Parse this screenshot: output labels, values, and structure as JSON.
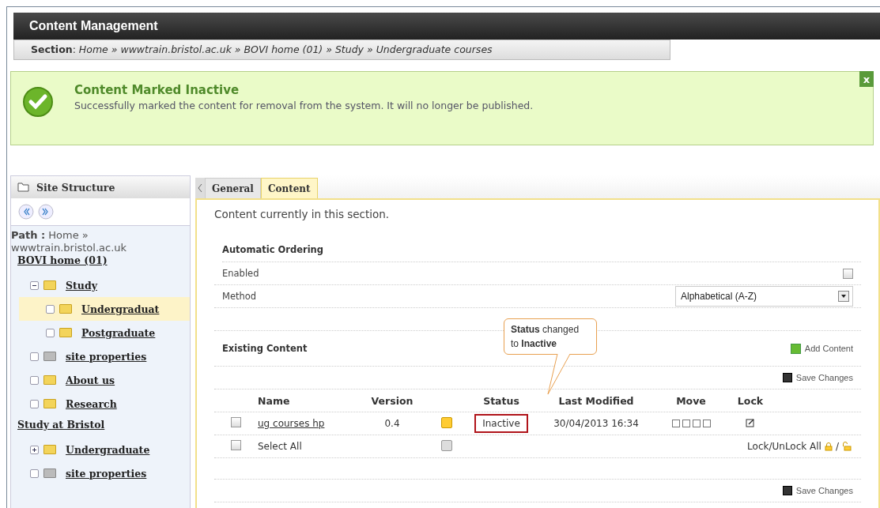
{
  "header": {
    "title": "Content Management",
    "breadcrumb": "**Section**: *Home » wwwtrain.bristol.ac.uk » BOVI home (01) » Study » Undergraduate courses*"
  },
  "message": {
    "title": "Content Marked Inactive",
    "text": "Successfully marked the content for removal from the system. It will no longer be published.",
    "close": "x"
  },
  "sidebar": {
    "title": "Site Structure",
    "path_label": "Path :",
    "path": "Home » wwwtrain.bristol.ac.uk",
    "roots": [
      {
        "label": "BOVI home (01)",
        "children": [
          {
            "label": "Study",
            "kind": "folder",
            "expanded": true,
            "selected": false,
            "children": [
              {
                "label": "Undergraduat",
                "kind": "folder",
                "selected": true
              },
              {
                "label": "Postgraduate",
                "kind": "folder",
                "selected": false
              }
            ]
          },
          {
            "label": "site properties",
            "kind": "properties",
            "selected": false
          },
          {
            "label": "About us",
            "kind": "folder",
            "selected": false
          },
          {
            "label": "Research",
            "kind": "folder",
            "selected": false
          }
        ]
      },
      {
        "label": "Study at Bristol",
        "children": [
          {
            "label": "Undergraduate",
            "kind": "folder",
            "expanded": false,
            "selected": false
          },
          {
            "label": "site properties",
            "kind": "properties",
            "selected": false
          }
        ]
      }
    ]
  },
  "tabs": [
    {
      "label": "General",
      "selected": false
    },
    {
      "label": "Content",
      "selected": true
    }
  ],
  "intro": "Content currently in this section.",
  "ordering": {
    "title": "Automatic Ordering",
    "enabled_label": "Enabled",
    "enabled": false,
    "method_label": "Method",
    "method": "Alphabetical (A-Z)"
  },
  "existing": {
    "title": "Existing Content",
    "add": "Add Content",
    "save": "Save Changes",
    "columns": [
      "Name",
      "Version",
      "Status",
      "Last Modified",
      "Move",
      "Lock"
    ],
    "rows": [
      {
        "checked": false,
        "name": "ug courses hp",
        "version": "0.4",
        "status": "Inactive",
        "highlighted": true,
        "modified": "30/04/2013 16:34"
      }
    ],
    "select_all": "Select All",
    "select_all_checked": false,
    "lock_all": "Lock/UnLock All",
    "slash": "/",
    "save_bottom": "Save Changes"
  },
  "callout": "**Status** changed to **Inactive**"
}
